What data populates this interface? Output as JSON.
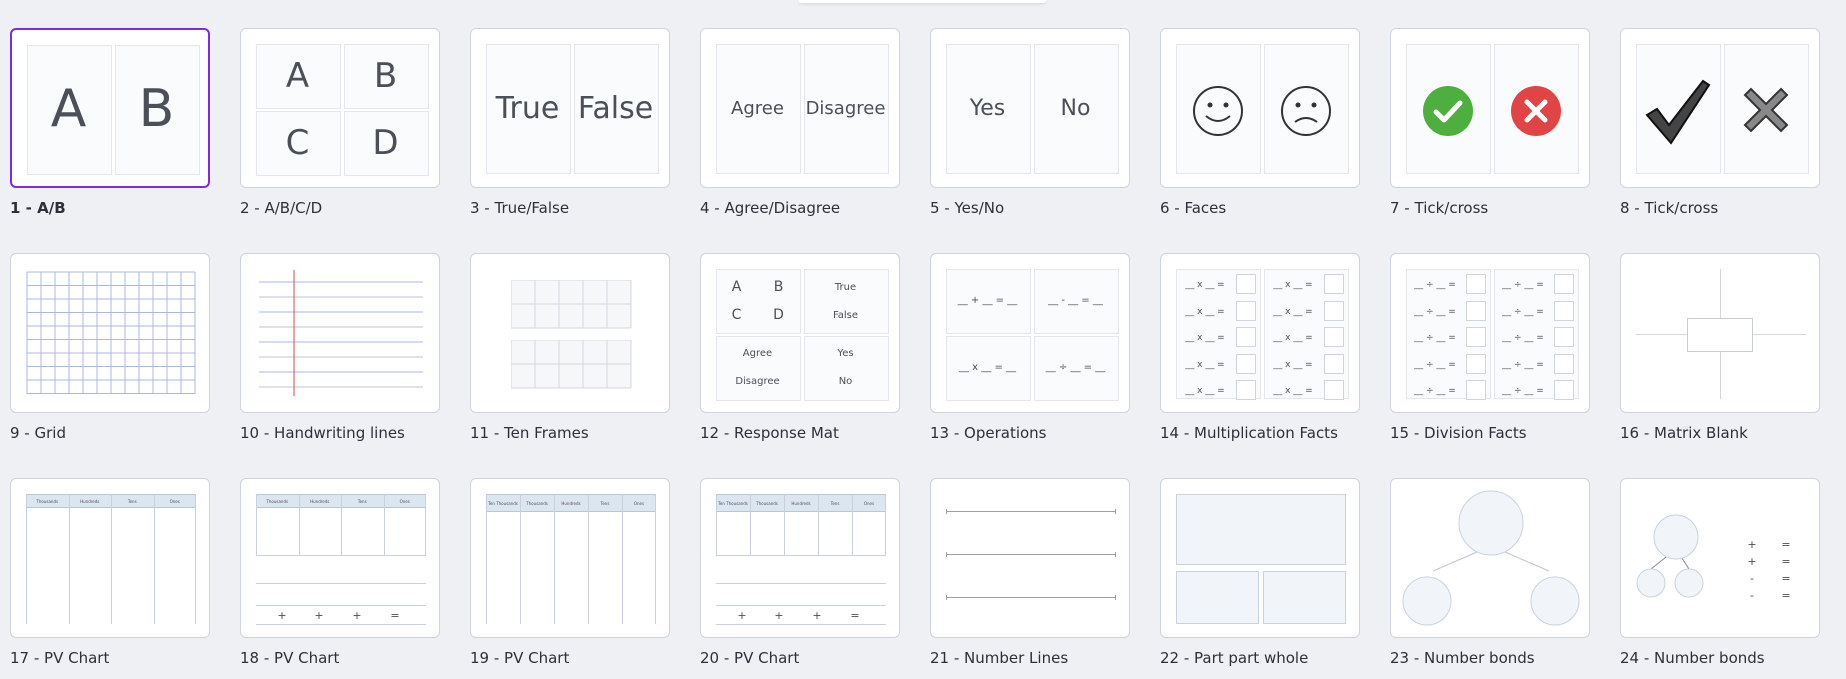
{
  "templates": [
    {
      "label": "1 - A/B",
      "texts": [
        "A",
        "B"
      ]
    },
    {
      "label": "2 - A/B/C/D",
      "texts": [
        "A",
        "B",
        "C",
        "D"
      ]
    },
    {
      "label": "3 - True/False",
      "texts": [
        "True",
        "False"
      ]
    },
    {
      "label": "4 - Agree/Disagree",
      "texts": [
        "Agree",
        "Disagree"
      ]
    },
    {
      "label": "5 - Yes/No",
      "texts": [
        "Yes",
        "No"
      ]
    },
    {
      "label": "6 - Faces"
    },
    {
      "label": "7 - Tick/cross"
    },
    {
      "label": "8 - Tick/cross"
    },
    {
      "label": "9 - Grid"
    },
    {
      "label": "10 - Handwriting lines"
    },
    {
      "label": "11 - Ten Frames"
    },
    {
      "label": "12 - Response Mat",
      "texts": [
        "A",
        "B",
        "C",
        "D",
        "True",
        "False",
        "Agree",
        "Disagree",
        "Yes",
        "No"
      ]
    },
    {
      "label": "13 - Operations",
      "texts": [
        "__ + __ = __",
        "__ - __ = __",
        "__ x __ = __",
        "__ ÷ __ = __"
      ]
    },
    {
      "label": "14 - Multiplication Facts",
      "fact": "__ x __ ="
    },
    {
      "label": "15 - Division Facts",
      "fact": "__ ÷ __ ="
    },
    {
      "label": "16 - Matrix Blank"
    },
    {
      "label": "17 - PV Chart",
      "headers": [
        "Thousands",
        "Hundreds",
        "Tens",
        "Ones"
      ]
    },
    {
      "label": "18 - PV Chart",
      "headers": [
        "Thousands",
        "Hundreds",
        "Tens",
        "Ones"
      ],
      "ops": [
        "+",
        "+",
        "+",
        "="
      ]
    },
    {
      "label": "19 - PV Chart",
      "headers": [
        "Ten Thousands",
        "Thousands",
        "Hundreds",
        "Tens",
        "Ones"
      ]
    },
    {
      "label": "20 - PV Chart",
      "headers": [
        "Ten Thousands",
        "Thousands",
        "Hundreds",
        "Tens",
        "Ones"
      ],
      "ops": [
        "+",
        "+",
        "+",
        "="
      ]
    },
    {
      "label": "21 - Number Lines"
    },
    {
      "label": "22 - Part part whole"
    },
    {
      "label": "23 - Number bonds"
    },
    {
      "label": "24 - Number bonds",
      "ops": [
        "+",
        "=",
        "+",
        "=",
        "-",
        "=",
        "-",
        "="
      ]
    }
  ],
  "selected_index": 0,
  "colors": {
    "accent": "#7d2ae8",
    "tick_green": "#4caf3e",
    "cross_red": "#e04444",
    "grid_blue": "#a9b7e6",
    "margin_red": "#e06666",
    "header_blue": "#dce6f0"
  }
}
